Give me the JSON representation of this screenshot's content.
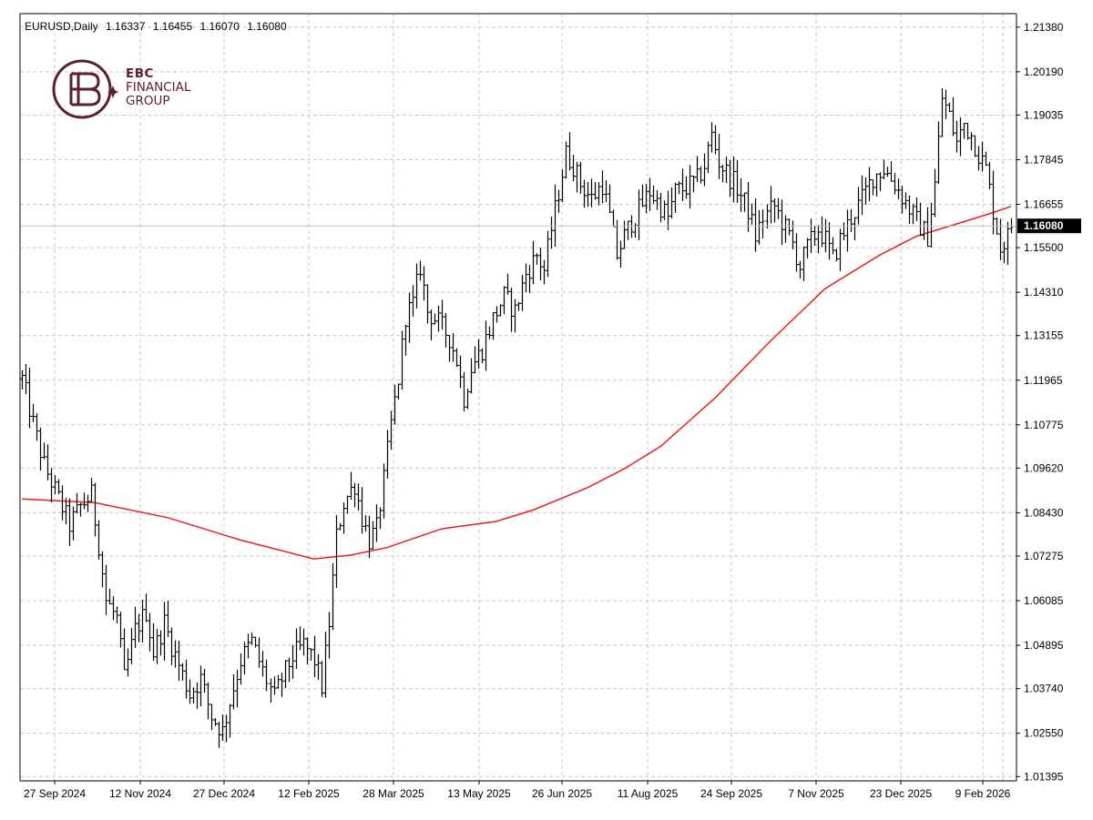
{
  "header": {
    "symbol": "EURUSD,Daily",
    "open": "1.16337",
    "high": "1.16455",
    "low": "1.16070",
    "close": "1.16080"
  },
  "logo": {
    "line1": "EBC",
    "line2": "FINANCIAL",
    "line3": "GROUP"
  },
  "colors": {
    "background": "#ffffff",
    "grid": "#c8c8c8",
    "bars": "#000000",
    "moving_average": "#e8201c",
    "current_price_line": "#c0c0c0",
    "price_tag_bg": "#000000",
    "brand": "#5a1f35"
  },
  "chart_data": {
    "type": "ohlc",
    "symbol": "EURUSD",
    "timeframe": "Daily",
    "x_tick_labels": [
      "27 Sep 2024",
      "12 Nov 2024",
      "27 Dec 2024",
      "12 Feb 2025",
      "28 Mar 2025",
      "13 May 2025",
      "26 Jun 2025",
      "11 Aug 2025",
      "24 Sep 2025",
      "7 Nov 2025",
      "23 Dec 2025",
      "9 Feb 2026"
    ],
    "y_ticks": [
      1.2138,
      1.2019,
      1.19035,
      1.17845,
      1.16655,
      1.155,
      1.1431,
      1.13155,
      1.11965,
      1.10775,
      1.0962,
      1.0843,
      1.07275,
      1.06085,
      1.04895,
      1.0374,
      1.0255,
      1.01395
    ],
    "y_tick_labels": [
      "1.21380",
      "1.20190",
      "1.19035",
      "1.17845",
      "1.16655",
      "1.15500",
      "1.14310",
      "1.13155",
      "1.11965",
      "1.10775",
      "1.09620",
      "1.08430",
      "1.07275",
      "1.06085",
      "1.04895",
      "1.03740",
      "1.02550",
      "1.01395"
    ],
    "ylim": [
      1.0128,
      1.2174
    ],
    "grid": true,
    "current_price": 1.1608,
    "current_price_label": "1.16080",
    "price_path": [
      [
        0,
        1.12
      ],
      [
        3,
        1.108
      ],
      [
        6,
        1.097
      ],
      [
        10,
        1.088
      ],
      [
        13,
        1.081
      ],
      [
        16,
        1.086
      ],
      [
        19,
        1.089
      ],
      [
        21,
        1.076
      ],
      [
        23,
        1.061
      ],
      [
        26,
        1.056
      ],
      [
        28,
        1.04
      ],
      [
        31,
        1.053
      ],
      [
        34,
        1.058
      ],
      [
        36,
        1.047
      ],
      [
        39,
        1.055
      ],
      [
        41,
        1.049
      ],
      [
        44,
        1.041
      ],
      [
        46,
        1.036
      ],
      [
        49,
        1.04
      ],
      [
        52,
        1.03
      ],
      [
        55,
        1.026
      ],
      [
        57,
        1.034
      ],
      [
        60,
        1.045
      ],
      [
        63,
        1.05
      ],
      [
        66,
        1.042
      ],
      [
        69,
        1.035
      ],
      [
        71,
        1.04
      ],
      [
        74,
        1.046
      ],
      [
        77,
        1.049
      ],
      [
        80,
        1.045
      ],
      [
        82,
        1.038
      ],
      [
        84,
        1.055
      ],
      [
        86,
        1.078
      ],
      [
        88,
        1.087
      ],
      [
        91,
        1.092
      ],
      [
        93,
        1.083
      ],
      [
        95,
        1.077
      ],
      [
        97,
        1.08
      ],
      [
        99,
        1.093
      ],
      [
        101,
        1.108
      ],
      [
        103,
        1.12
      ],
      [
        105,
        1.137
      ],
      [
        107,
        1.14
      ],
      [
        109,
        1.15
      ],
      [
        111,
        1.138
      ],
      [
        114,
        1.135
      ],
      [
        117,
        1.131
      ],
      [
        119,
        1.125
      ],
      [
        121,
        1.115
      ],
      [
        123,
        1.123
      ],
      [
        126,
        1.128
      ],
      [
        129,
        1.136
      ],
      [
        132,
        1.142
      ],
      [
        135,
        1.138
      ],
      [
        138,
        1.148
      ],
      [
        141,
        1.153
      ],
      [
        143,
        1.149
      ],
      [
        145,
        1.16
      ],
      [
        147,
        1.17
      ],
      [
        149,
        1.18
      ],
      [
        151,
        1.177
      ],
      [
        153,
        1.172
      ],
      [
        156,
        1.168
      ],
      [
        159,
        1.172
      ],
      [
        161,
        1.163
      ],
      [
        163,
        1.153
      ],
      [
        165,
        1.158
      ],
      [
        167,
        1.162
      ],
      [
        169,
        1.165
      ],
      [
        172,
        1.17
      ],
      [
        175,
        1.166
      ],
      [
        177,
        1.163
      ],
      [
        179,
        1.17
      ],
      [
        182,
        1.171
      ],
      [
        185,
        1.173
      ],
      [
        187,
        1.177
      ],
      [
        189,
        1.185
      ],
      [
        191,
        1.178
      ],
      [
        193,
        1.175
      ],
      [
        196,
        1.171
      ],
      [
        199,
        1.165
      ],
      [
        201,
        1.158
      ],
      [
        203,
        1.163
      ],
      [
        206,
        1.166
      ],
      [
        209,
        1.16
      ],
      [
        211,
        1.156
      ],
      [
        213,
        1.15
      ],
      [
        215,
        1.155
      ],
      [
        218,
        1.16
      ],
      [
        220,
        1.157
      ],
      [
        222,
        1.152
      ],
      [
        224,
        1.157
      ],
      [
        227,
        1.163
      ],
      [
        230,
        1.168
      ],
      [
        233,
        1.174
      ],
      [
        236,
        1.176
      ],
      [
        239,
        1.172
      ],
      [
        242,
        1.167
      ],
      [
        245,
        1.162
      ],
      [
        248,
        1.158
      ],
      [
        250,
        1.172
      ],
      [
        252,
        1.195
      ],
      [
        254,
        1.19
      ],
      [
        256,
        1.183
      ],
      [
        258,
        1.188
      ],
      [
        260,
        1.185
      ],
      [
        262,
        1.18
      ],
      [
        264,
        1.176
      ],
      [
        266,
        1.165
      ],
      [
        268,
        1.155
      ],
      [
        270,
        1.158
      ],
      [
        271,
        1.161
      ]
    ],
    "ma_path": [
      [
        0,
        1.088
      ],
      [
        20,
        1.087
      ],
      [
        40,
        1.083
      ],
      [
        60,
        1.077
      ],
      [
        80,
        1.072
      ],
      [
        90,
        1.073
      ],
      [
        100,
        1.075
      ],
      [
        115,
        1.08
      ],
      [
        130,
        1.082
      ],
      [
        140,
        1.085
      ],
      [
        155,
        1.091
      ],
      [
        165,
        1.096
      ],
      [
        175,
        1.102
      ],
      [
        190,
        1.115
      ],
      [
        205,
        1.13
      ],
      [
        220,
        1.144
      ],
      [
        235,
        1.153
      ],
      [
        245,
        1.158
      ],
      [
        255,
        1.161
      ],
      [
        265,
        1.164
      ],
      [
        271,
        1.166
      ]
    ]
  }
}
